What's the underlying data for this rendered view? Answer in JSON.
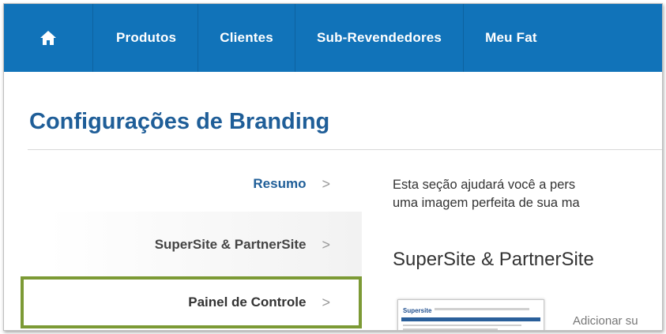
{
  "navbar": {
    "home_icon": "home-icon",
    "items": [
      {
        "label": "Produtos"
      },
      {
        "label": "Clientes"
      },
      {
        "label": "Sub-Revendedores"
      },
      {
        "label": "Meu Fat"
      }
    ]
  },
  "page": {
    "title": "Configurações de Branding"
  },
  "sidebar": {
    "items": [
      {
        "label": "Resumo",
        "chevron": ">"
      },
      {
        "label": "SuperSite & PartnerSite",
        "chevron": ">"
      },
      {
        "label": "Painel de Controle",
        "chevron": ">"
      }
    ]
  },
  "content": {
    "intro_line1": "Esta seção ajudará você a pers",
    "intro_line2": "uma imagem perfeita de sua ma",
    "section_heading": "SuperSite & PartnerSite",
    "thumbnail_logo": "Supersite",
    "adicionar_text": "Adicionar su"
  },
  "colors": {
    "nav_bg": "#1173b9",
    "title": "#1f5e98",
    "highlight_border": "#7c9a35"
  }
}
